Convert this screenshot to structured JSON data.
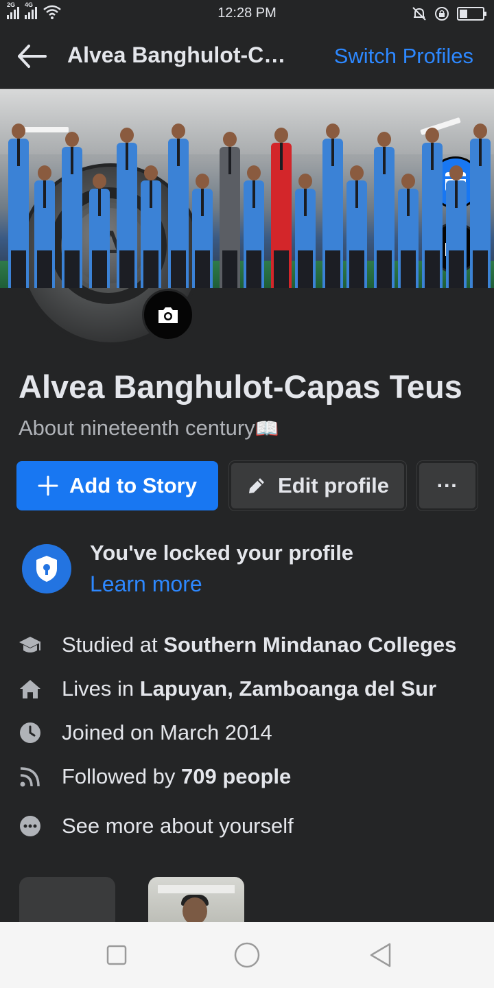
{
  "status_bar": {
    "time": "12:28 PM",
    "signal1_label": "2G",
    "signal2_label": "4G",
    "battery_level": 0.35
  },
  "header": {
    "title": "Alvea Banghulot-Capas Teus",
    "switch_profiles": "Switch Profiles"
  },
  "profile": {
    "name": "Alvea Banghulot-Capas Teus",
    "bio": "About nineteenth century",
    "bio_emoji": "📖",
    "avatar_letter": "A"
  },
  "actions": {
    "add_to_story": "Add to Story",
    "edit_profile": "Edit profile",
    "more": "···"
  },
  "lock": {
    "title": "You've locked your profile",
    "link": "Learn more"
  },
  "details": {
    "studied_prefix": "Studied at ",
    "studied_value": "Southern Mindanao Colleges",
    "lives_prefix": "Lives in ",
    "lives_value": "Lapuyan, Zamboanga del Sur",
    "joined": "Joined on March 2014",
    "followed_prefix": "Followed by ",
    "followed_value": "709 people",
    "see_more": "See more about yourself"
  },
  "icons": {
    "back": "arrow-left-icon",
    "camera": "camera-icon",
    "avatar_frame": "smile-frame-icon",
    "plus": "plus-icon",
    "pencil": "pencil-icon",
    "shield": "shield-lock-icon",
    "education": "graduation-cap-icon",
    "home": "home-icon",
    "clock": "clock-icon",
    "rss": "rss-icon",
    "more": "ellipsis-circle-icon"
  },
  "colors": {
    "background": "#242526",
    "primary_blue": "#1877f2",
    "link_blue": "#2d88ff",
    "secondary_text": "#b0b3b8",
    "nav_bar": "#f5f5f5"
  }
}
